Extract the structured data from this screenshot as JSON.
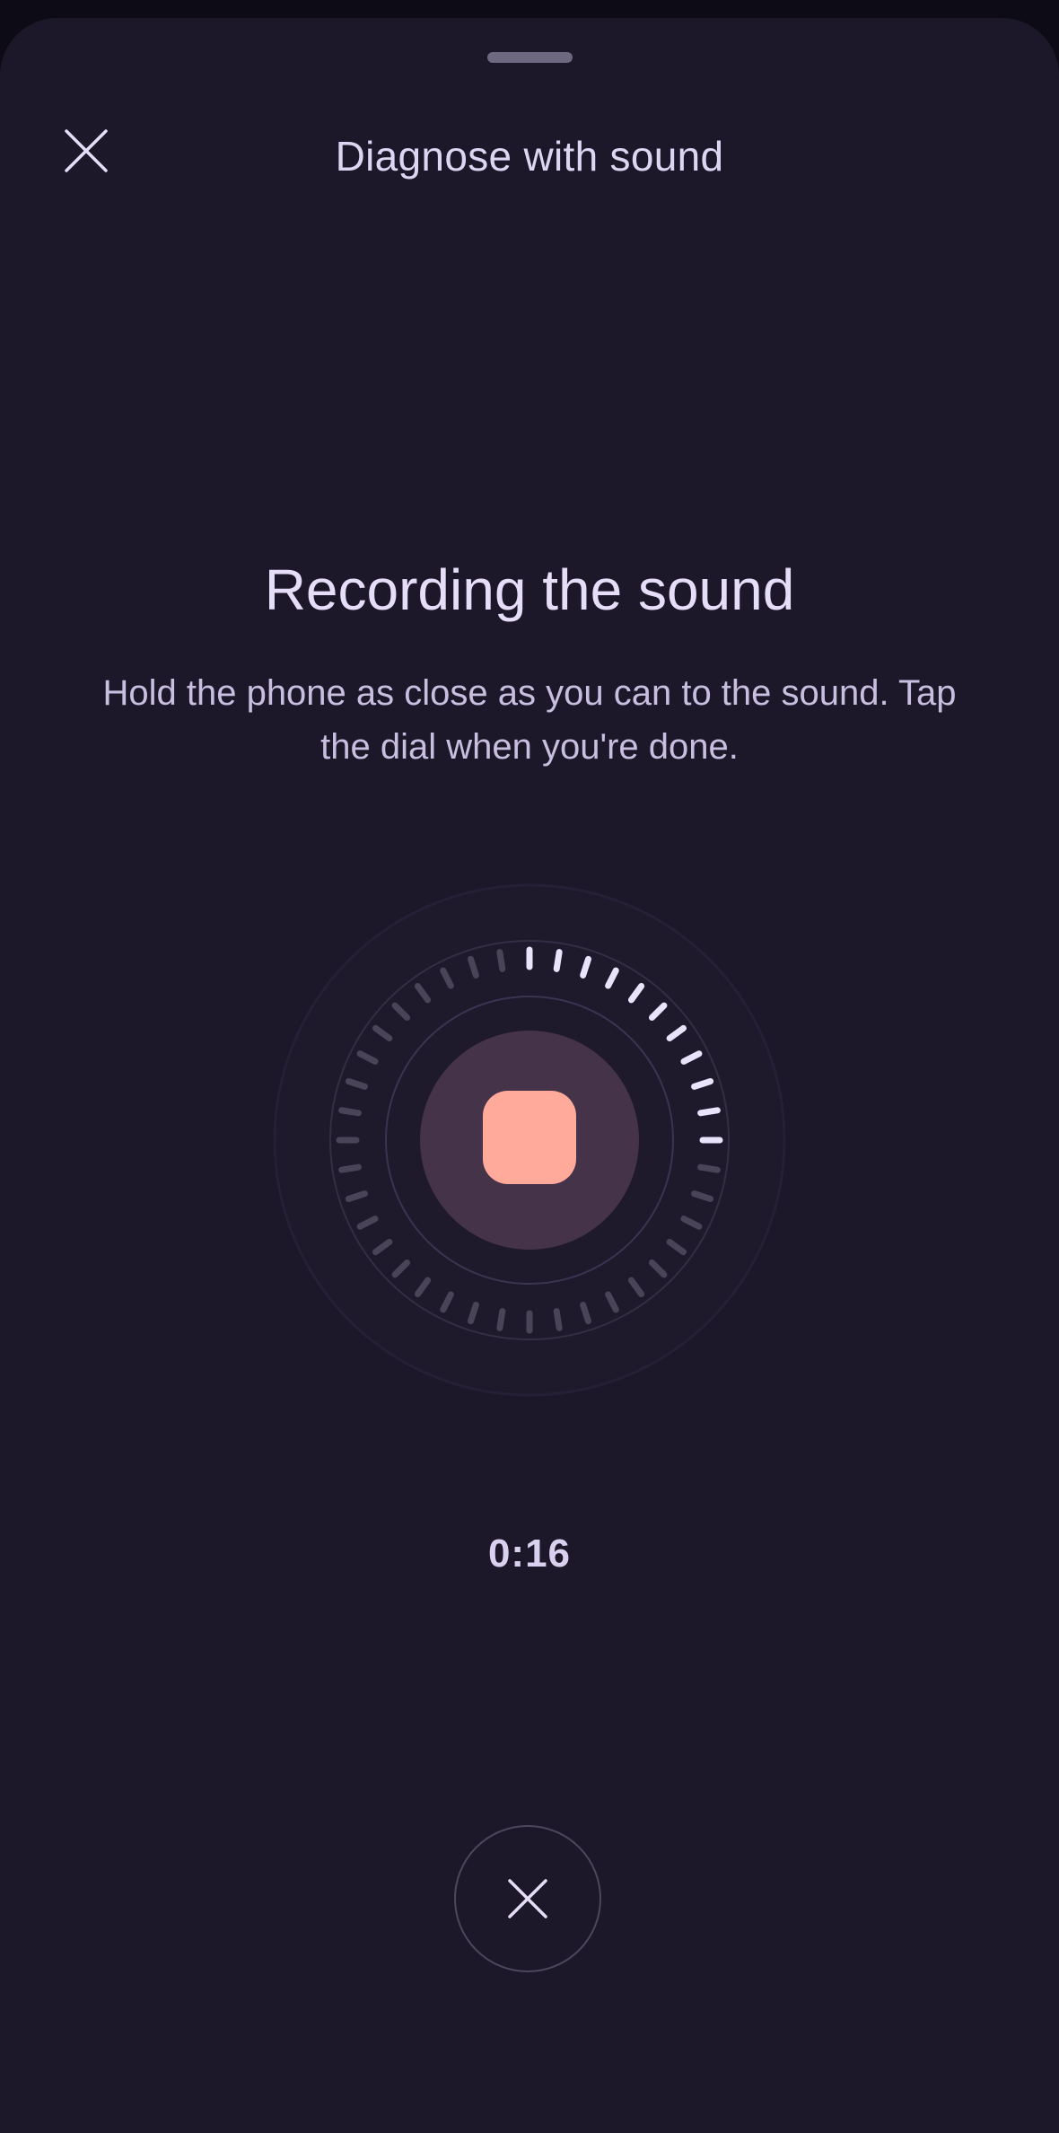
{
  "header": {
    "title": "Diagnose with sound",
    "close_icon": "close-icon"
  },
  "main": {
    "title": "Recording the sound",
    "description": "Hold the phone as close as you can to the sound. Tap the dial when you're done."
  },
  "recorder": {
    "progress_fraction": 0.28,
    "timer": "0:16",
    "stop_icon": "stop-icon",
    "cancel_icon": "close-icon"
  },
  "colors": {
    "background": "#1c1829",
    "accent": "#ffaa9b",
    "text": "#e6def8",
    "tick_active": "#e9e3fb",
    "tick_inactive": "#4a4458"
  }
}
